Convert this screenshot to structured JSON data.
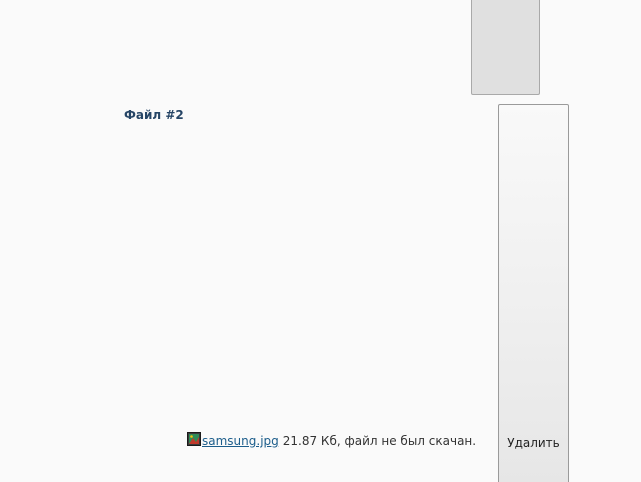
{
  "upload_form": {
    "file_heading": "Файл #2",
    "file": {
      "icon": "image-file-icon",
      "name": " samsung.jpg",
      "info": "21.87 Кб, файл не был скачан."
    },
    "delete_button_label": "Удалить"
  },
  "colors": {
    "background": "#fafafa",
    "heading": "#264566",
    "link": "#1c5d8b",
    "button_border": "#9a9a9a"
  }
}
